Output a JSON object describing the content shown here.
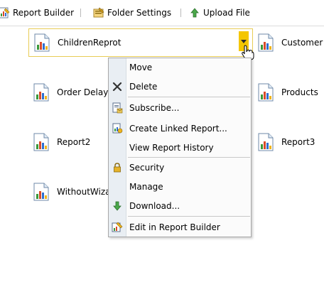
{
  "toolbar": {
    "items": [
      {
        "label": "Report Builder",
        "icon": "report-builder-icon"
      },
      {
        "label": "Folder Settings",
        "icon": "folder-settings-icon"
      },
      {
        "label": "Upload File",
        "icon": "upload-icon"
      }
    ]
  },
  "reports": [
    {
      "name": "ChildrenReprot",
      "selected": true
    },
    {
      "name": "Customer C"
    },
    {
      "name": "Order Delays"
    },
    {
      "name": "Products"
    },
    {
      "name": "Report2"
    },
    {
      "name": "Report3"
    },
    {
      "name": "WithoutWiza"
    }
  ],
  "context_menu": {
    "items": [
      {
        "label": "Move",
        "icon": ""
      },
      {
        "label": "Delete",
        "icon": "delete-x-icon"
      },
      {
        "label": "Subscribe...",
        "icon": "subscribe-icon"
      },
      {
        "label": "Create Linked Report...",
        "icon": "linked-report-icon"
      },
      {
        "label": "View Report History",
        "icon": ""
      },
      {
        "label": "Security",
        "icon": "lock-icon"
      },
      {
        "label": "Manage",
        "icon": ""
      },
      {
        "label": "Download...",
        "icon": "download-arrow-icon"
      },
      {
        "label": "Edit in Report Builder",
        "icon": "edit-report-icon"
      }
    ]
  },
  "colors": {
    "dropdown_accent": "#f4c600",
    "selected_border": "#e8cc55",
    "menu_gutter": "#e9eef3"
  }
}
